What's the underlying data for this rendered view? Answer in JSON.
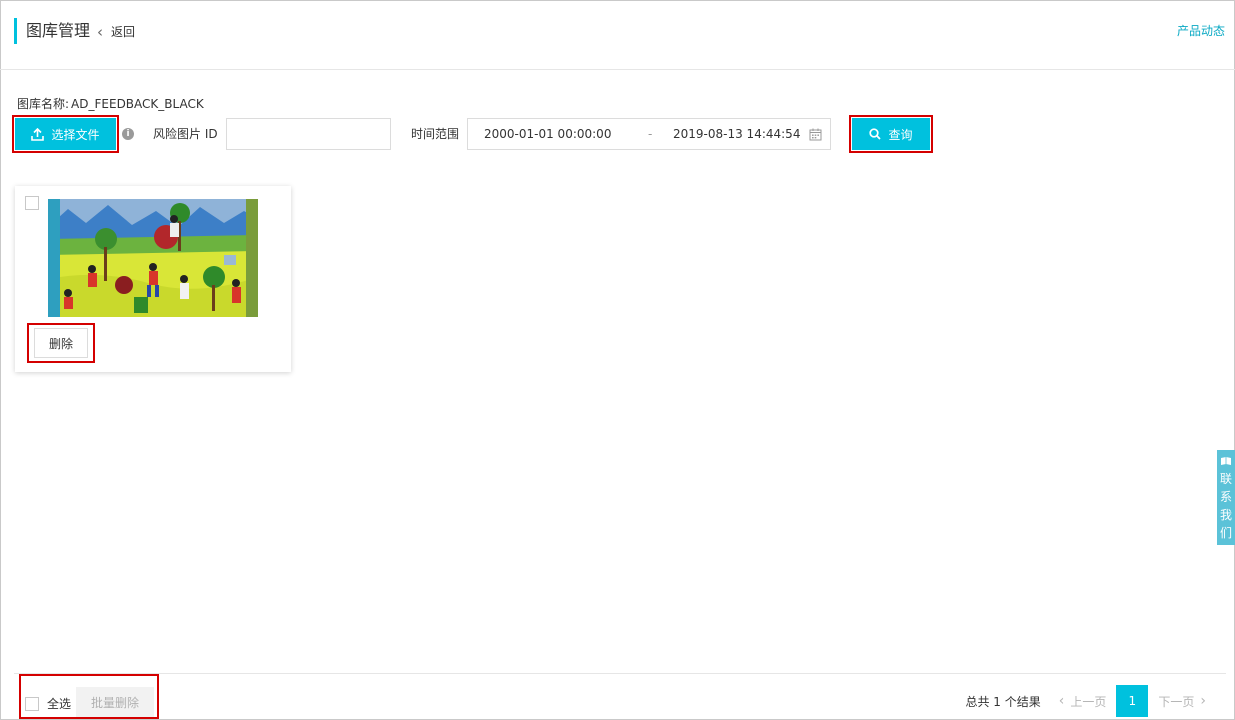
{
  "header": {
    "title": "图库管理",
    "back_label": "返回",
    "product_news": "产品动态"
  },
  "library": {
    "name_label": "图库名称:",
    "name_value": "AD_FEEDBACK_BLACK"
  },
  "toolbar": {
    "upload_label": "选择文件",
    "info_icon": "info-icon",
    "risk_id_label": "风险图片 ID",
    "risk_id_value": "",
    "time_range_label": "时间范围",
    "time_start": "2000-01-01 00:00:00",
    "time_separator": "-",
    "time_end": "2019-08-13 14:44:54",
    "search_label": "查询"
  },
  "gallery": {
    "items": [
      {
        "delete_label": "删除",
        "checked": false
      }
    ]
  },
  "contact": {
    "label": "联系我们"
  },
  "footer": {
    "select_all_label": "全选",
    "batch_delete_label": "批量删除",
    "total_text": "总共 1 个结果",
    "prev_label": "上一页",
    "current_page": "1",
    "next_label": "下一页"
  },
  "colors": {
    "accent": "#00c1de",
    "highlight_box": "#d40000",
    "link": "#0aa9c4"
  }
}
